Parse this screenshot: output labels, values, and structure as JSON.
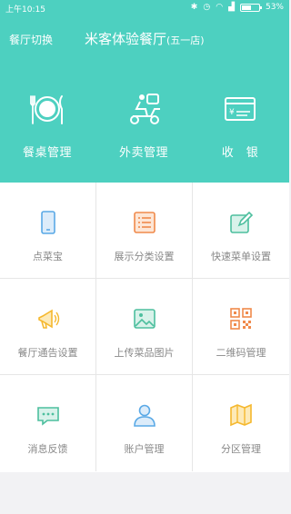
{
  "status": {
    "time": "上午10:15",
    "battery": "53%",
    "battery_level": 0.53
  },
  "header": {
    "switch_label": "餐厅切换",
    "title": "米客体验餐厅",
    "subtitle": "(五一店)"
  },
  "hero": [
    {
      "label": "餐桌管理",
      "icon": "tableware-icon"
    },
    {
      "label": "外卖管理",
      "icon": "delivery-scooter-icon"
    },
    {
      "label": "收　银",
      "icon": "cashier-card-icon"
    }
  ],
  "grid": [
    {
      "label": "点菜宝",
      "icon": "phone-icon",
      "color": "#5aa9e6"
    },
    {
      "label": "展示分类设置",
      "icon": "list-icon",
      "color": "#f08a4b"
    },
    {
      "label": "快速菜单设置",
      "icon": "edit-icon",
      "color": "#4dbf9e"
    },
    {
      "label": "餐厅通告设置",
      "icon": "megaphone-icon",
      "color": "#f5b82e"
    },
    {
      "label": "上传菜品图片",
      "icon": "image-icon",
      "color": "#4dbf9e"
    },
    {
      "label": "二维码管理",
      "icon": "qr-code-icon",
      "color": "#f08a4b"
    },
    {
      "label": "消息反馈",
      "icon": "chat-icon",
      "color": "#4dbf9e"
    },
    {
      "label": "账户管理",
      "icon": "user-icon",
      "color": "#5aa9e6"
    },
    {
      "label": "分区管理",
      "icon": "map-icon",
      "color": "#f5b82e"
    }
  ],
  "colors": {
    "header_bg": "#4dd0c0",
    "page_bg": "#f2f2f4"
  }
}
